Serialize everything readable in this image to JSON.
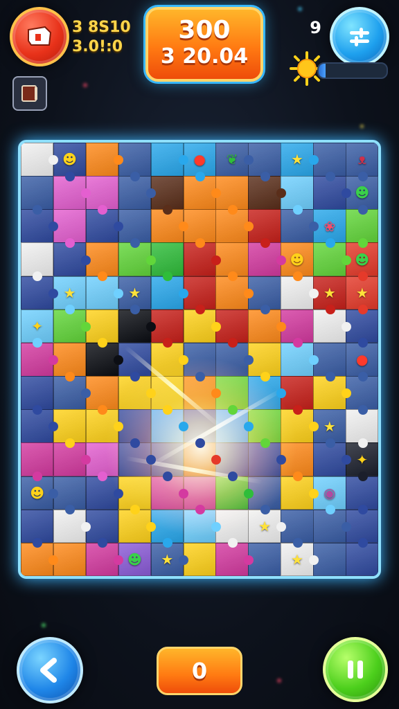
{
  "hud": {
    "left_stat_1": "3 8S10",
    "left_stat_2": "3.0!:0",
    "score_top": "300",
    "score_bottom": "3 20.04",
    "small_counter": "9",
    "progress_fraction": 0.1
  },
  "bottom": {
    "counter": "0"
  },
  "colors": {
    "accent_orange": "#ff7a12",
    "board_glow": "#3fb6ff",
    "pieces": [
      "#2f4aa0",
      "#e53a2a",
      "#ff8a1a",
      "#ffd21a",
      "#2fbd3a",
      "#29a8ec",
      "#e45fd0",
      "#8b5bd8",
      "#f1f1f1",
      "#1b1f2c",
      "#3a5ea6"
    ]
  },
  "board": {
    "cols": 11,
    "rows": 13,
    "pattern": [
      "1A3B55BB5BB",
      "B88BF33F9AB",
      "A8AB333DB5C",
      "1A3C4D3E3C7",
      "A99B5D3B1D7",
      "9C2ZD2D3E1A",
      "E3ZA2BB29BB",
      "AB3223C5D2B",
      "A22A5A5C2B1",
      "EE8AA7AA3A0",
      "BBA2EE4B29A",
      "A1A25911BBA",
      "33E6B2EB1BA"
    ],
    "pattern_legend": "0=dark,1=white,2=yellow,3=orange,4=green,5=blue,6=purple,7=red,8=pink,9=lightblue,A=navy,B=slate,C=lime,D=deepred,E=magenta,F=brown,Z=black",
    "glyphs": [
      {
        "r": 0,
        "c": 1,
        "icon": "smiley-face-icon"
      },
      {
        "r": 0,
        "c": 5,
        "icon": "ladybug-icon"
      },
      {
        "r": 0,
        "c": 6,
        "icon": "leaf-icon"
      },
      {
        "r": 0,
        "c": 8,
        "icon": "star-icon"
      },
      {
        "r": 0,
        "c": 10,
        "icon": "bat-icon"
      },
      {
        "r": 1,
        "c": 10,
        "icon": "frog-icon"
      },
      {
        "r": 2,
        "c": 9,
        "icon": "cherry-icon"
      },
      {
        "r": 3,
        "c": 8,
        "icon": "smiley-face-icon"
      },
      {
        "r": 3,
        "c": 10,
        "icon": "frog-icon"
      },
      {
        "r": 4,
        "c": 1,
        "icon": "star-icon"
      },
      {
        "r": 4,
        "c": 3,
        "icon": "star-icon"
      },
      {
        "r": 4,
        "c": 9,
        "icon": "star-icon"
      },
      {
        "r": 4,
        "c": 10,
        "icon": "star-icon"
      },
      {
        "r": 5,
        "c": 0,
        "icon": "bird-icon"
      },
      {
        "r": 6,
        "c": 10,
        "icon": "ladybug-icon"
      },
      {
        "r": 8,
        "c": 9,
        "icon": "star-icon"
      },
      {
        "r": 9,
        "c": 10,
        "icon": "bird-icon"
      },
      {
        "r": 10,
        "c": 0,
        "icon": "chick-icon"
      },
      {
        "r": 10,
        "c": 9,
        "icon": "owl-icon"
      },
      {
        "r": 11,
        "c": 7,
        "icon": "star-icon"
      },
      {
        "r": 12,
        "c": 3,
        "icon": "frog-icon"
      },
      {
        "r": 12,
        "c": 4,
        "icon": "star-icon"
      },
      {
        "r": 12,
        "c": 8,
        "icon": "star-icon"
      }
    ]
  }
}
